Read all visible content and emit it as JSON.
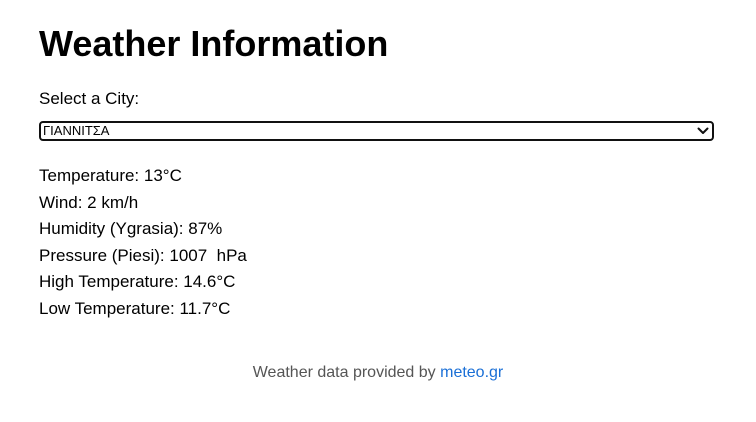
{
  "page": {
    "title": "Weather Information"
  },
  "city_selector": {
    "label": "Select a City:",
    "selected": "ΓΙΑΝΝΙΤΣΑ"
  },
  "weather": {
    "temperature": "Temperature: 13°C",
    "wind": "Wind: 2 km/h",
    "humidity": "Humidity (Ygrasia): 87%",
    "pressure": "Pressure (Piesi): 1007  hPa",
    "high_temperature": "High Temperature: 14.6°C",
    "low_temperature": "Low Temperature: 11.7°C"
  },
  "footer": {
    "text": "Weather data provided by ",
    "link_label": "meteo.gr",
    "link_color": "#1a6fd6"
  },
  "icons": {
    "dropdown": "chevron-down-icon"
  }
}
